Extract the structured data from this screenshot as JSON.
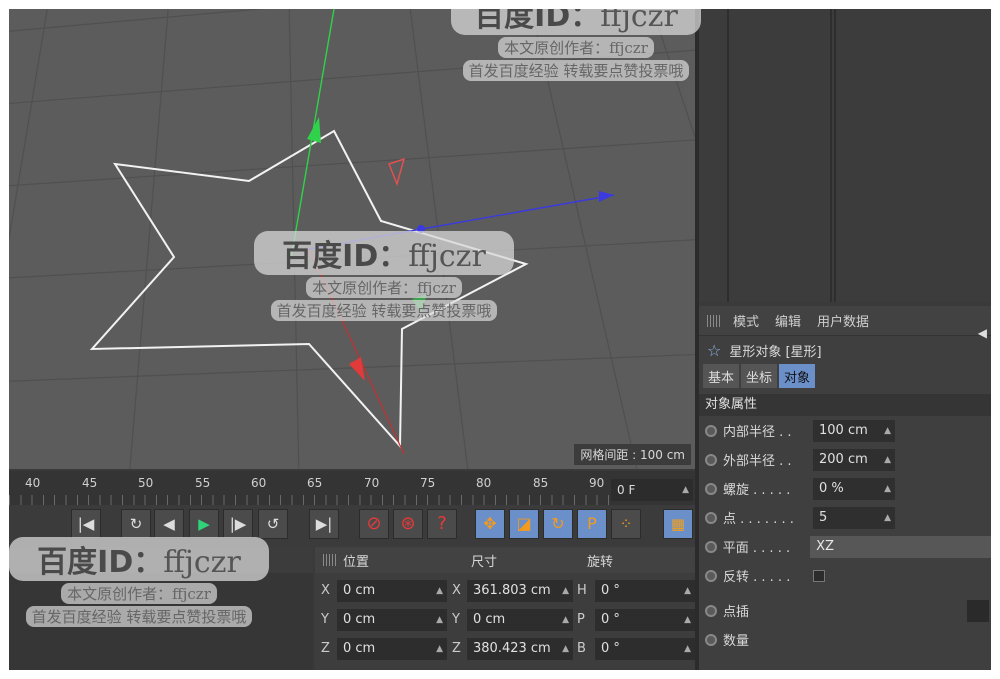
{
  "viewport": {
    "grid_spacing_label": "网格间距 : 100 cm"
  },
  "timeline": {
    "ticks": [
      "40",
      "45",
      "50",
      "55",
      "60",
      "65",
      "70",
      "75",
      "80",
      "85",
      "90"
    ],
    "current_frame": "0 F"
  },
  "attribute_manager": {
    "menu": [
      "模式",
      "编辑",
      "用户数据"
    ],
    "object_title": "星形对象 [星形]",
    "tabs": [
      "基本",
      "坐标",
      "对象"
    ],
    "active_tab": "对象",
    "section": "对象属性",
    "properties": [
      {
        "label": "内部半径 . .",
        "value": "100 cm"
      },
      {
        "label": "外部半径 . .",
        "value": "200 cm"
      },
      {
        "label": "螺旋 . . . . .",
        "value": "0 %"
      },
      {
        "label": "点 . . . . . . .",
        "value": "5"
      },
      {
        "label": "平面 . . . . .",
        "value": "XZ"
      },
      {
        "label": "反转 . . . . .",
        "value": ""
      },
      {
        "label": "点插",
        "value": ""
      },
      {
        "label": "数量",
        "value": ""
      }
    ]
  },
  "coordinates": {
    "headers": [
      "位置",
      "尺寸",
      "旋转"
    ],
    "rows": [
      {
        "axis1": "X",
        "pos": "0 cm",
        "axis2": "X",
        "size": "361.803 cm",
        "axis3": "H",
        "rot": "0 °"
      },
      {
        "axis1": "Y",
        "pos": "0 cm",
        "axis2": "Y",
        "size": "0 cm",
        "axis3": "P",
        "rot": "0 °"
      },
      {
        "axis1": "Z",
        "pos": "0 cm",
        "axis2": "Z",
        "size": "380.423 cm",
        "axis3": "B",
        "rot": "0 °"
      }
    ]
  },
  "watermark": {
    "title": "百度",
    "id_text": "ID：",
    "handle": "ffjczr",
    "line1": "本文原创作者：ffjczr",
    "line2": "首发百度经验  转载要点赞投票哦"
  },
  "colors": {
    "viewport_bg": "#5c5c5c",
    "panel_bg": "#3c3c3c",
    "accent_blue": "#6b8fc9",
    "axis_green": "#2fd24a",
    "axis_red": "#e03a3a",
    "axis_blue": "#3a3ae0"
  }
}
